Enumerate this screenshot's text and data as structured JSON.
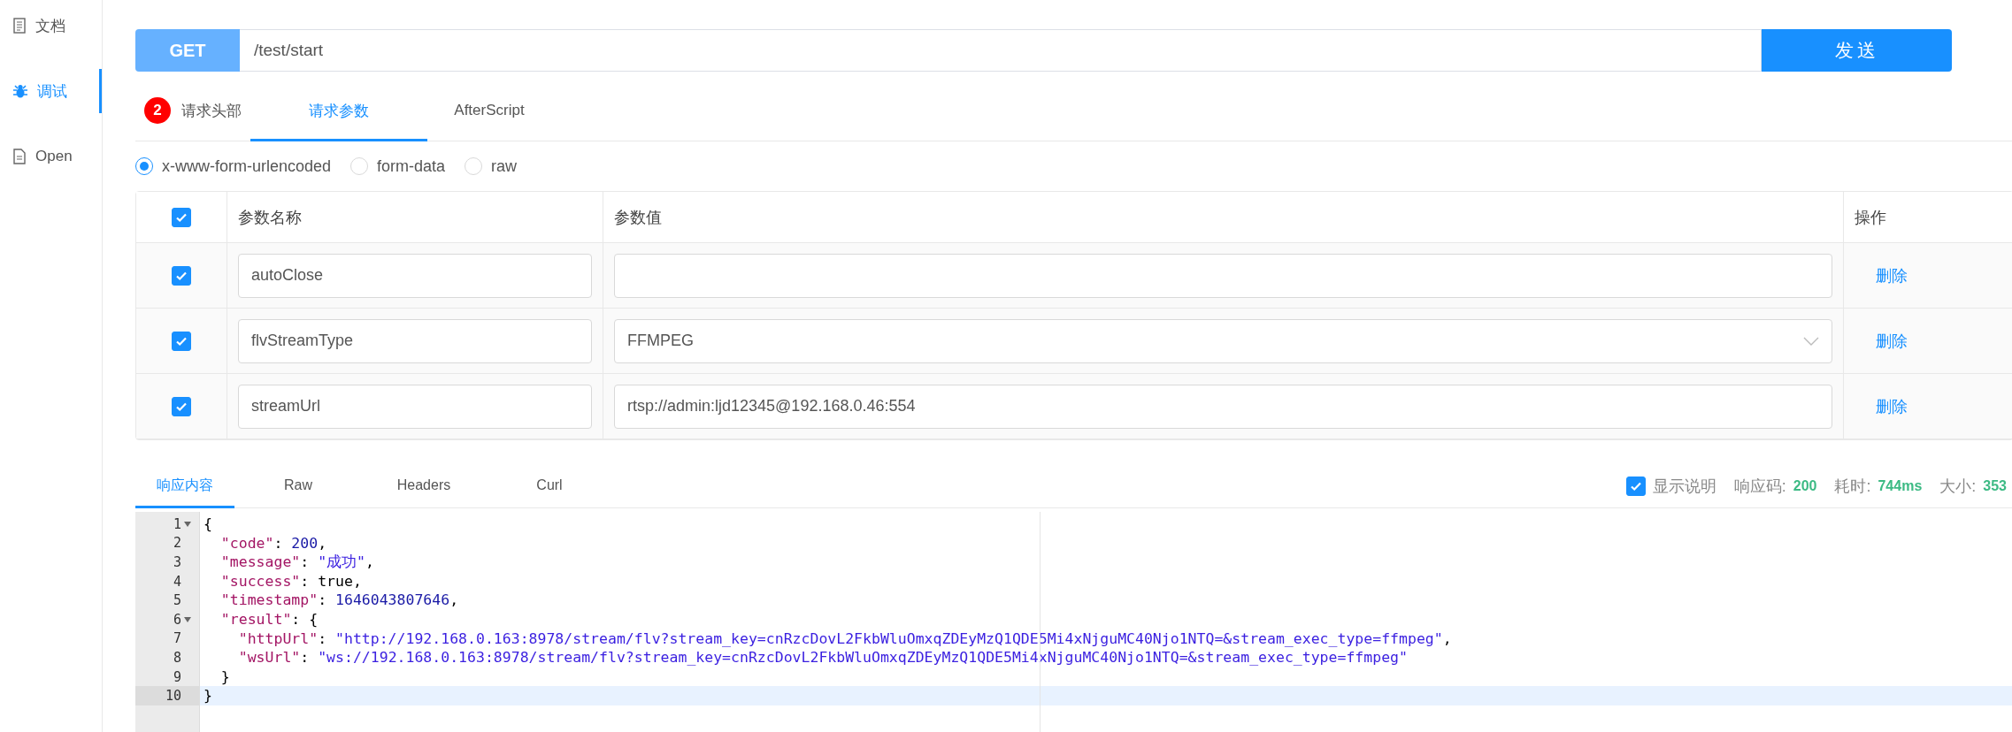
{
  "sidebar": {
    "items": [
      {
        "label": "文档",
        "selected": false
      },
      {
        "label": "调试",
        "selected": true
      },
      {
        "label": "Open",
        "selected": false
      }
    ]
  },
  "request": {
    "method": "GET",
    "url": "/test/start",
    "send_button": "发送"
  },
  "request_tabs": [
    {
      "label": "请求头部",
      "badge": "2",
      "selected": false
    },
    {
      "label": "请求参数",
      "selected": true
    },
    {
      "label": "AfterScript",
      "selected": false
    }
  ],
  "body_types": [
    {
      "label": "x-www-form-urlencoded",
      "selected": true
    },
    {
      "label": "form-data",
      "selected": false
    },
    {
      "label": "raw",
      "selected": false
    }
  ],
  "params_table": {
    "all_checked": true,
    "columns": [
      "参数名称",
      "参数值",
      "操作"
    ],
    "rows": [
      {
        "checked": true,
        "name": "autoClose",
        "kind": "input",
        "action": "删除"
      },
      {
        "checked": true,
        "name": "flvStreamType",
        "kind": "select",
        "value": "FFMPEG",
        "action": "删除"
      },
      {
        "checked": true,
        "name": "streamUrl",
        "kind": "input",
        "value": "rtsp://admin:ljd12345@192.168.0.46:554",
        "action": "删除"
      }
    ]
  },
  "response_tabs": [
    {
      "label": "响应内容",
      "selected": true
    },
    {
      "label": "Raw",
      "selected": false
    },
    {
      "label": "Headers",
      "selected": false
    },
    {
      "label": "Curl",
      "selected": false
    }
  ],
  "response_meta": {
    "show_description": {
      "label": "显示说明",
      "checked": true
    },
    "stats": [
      {
        "label": "响应码:",
        "value": "200"
      },
      {
        "label": "耗时:",
        "value": "744ms"
      },
      {
        "label": "大小:",
        "value": "353"
      }
    ]
  },
  "editor": {
    "lines": [
      {
        "number": "1",
        "fold": true,
        "selected": false,
        "tokens": [
          {
            "kind": "punct",
            "text": "{"
          }
        ]
      },
      {
        "number": "2",
        "fold": false,
        "selected": false,
        "tokens": [
          {
            "kind": "key",
            "text": "  \"code\""
          },
          {
            "kind": "punct",
            "text": ": "
          },
          {
            "kind": "number",
            "text": "200"
          },
          {
            "kind": "punct",
            "text": ","
          }
        ]
      },
      {
        "number": "3",
        "fold": false,
        "selected": false,
        "tokens": [
          {
            "kind": "key",
            "text": "  \"message\""
          },
          {
            "kind": "punct",
            "text": ": "
          },
          {
            "kind": "string",
            "text": "\"成功\""
          },
          {
            "kind": "punct",
            "text": ","
          }
        ]
      },
      {
        "number": "4",
        "fold": false,
        "selected": false,
        "tokens": [
          {
            "kind": "key",
            "text": "  \"success\""
          },
          {
            "kind": "punct",
            "text": ": true,"
          }
        ]
      },
      {
        "number": "5",
        "fold": false,
        "selected": false,
        "tokens": [
          {
            "kind": "key",
            "text": "  \"timestamp\""
          },
          {
            "kind": "punct",
            "text": ": "
          },
          {
            "kind": "number",
            "text": "1646043807646"
          },
          {
            "kind": "punct",
            "text": ","
          }
        ]
      },
      {
        "number": "6",
        "fold": true,
        "selected": false,
        "tokens": [
          {
            "kind": "key",
            "text": "  \"result\""
          },
          {
            "kind": "punct",
            "text": ": {"
          }
        ]
      },
      {
        "number": "7",
        "fold": false,
        "selected": false,
        "tokens": [
          {
            "kind": "key",
            "text": "    \"httpUrl\""
          },
          {
            "kind": "punct",
            "text": ": "
          },
          {
            "kind": "string",
            "text": "\"http://192.168.0.163:8978/stream/flv?stream_key=cnRzcDovL2FkbWluOmxqZDEyMzQ1QDE5Mi4xNjguMC40Njo1NTQ=&stream_exec_type=ffmpeg\""
          },
          {
            "kind": "punct",
            "text": ","
          }
        ]
      },
      {
        "number": "8",
        "fold": false,
        "selected": false,
        "tokens": [
          {
            "kind": "key",
            "text": "    \"wsUrl\""
          },
          {
            "kind": "punct",
            "text": ": "
          },
          {
            "kind": "string",
            "text": "\"ws://192.168.0.163:8978/stream/flv?stream_key=cnRzcDovL2FkbWluOmxqZDEyMzQ1QDE5Mi4xNjguMC40Njo1NTQ=&stream_exec_type=ffmpeg\""
          }
        ]
      },
      {
        "number": "9",
        "fold": false,
        "selected": false,
        "tokens": [
          {
            "kind": "punct",
            "text": "  }"
          }
        ]
      },
      {
        "number": "10",
        "fold": false,
        "selected": true,
        "tokens": [
          {
            "kind": "punct",
            "text": "}"
          }
        ]
      }
    ]
  }
}
